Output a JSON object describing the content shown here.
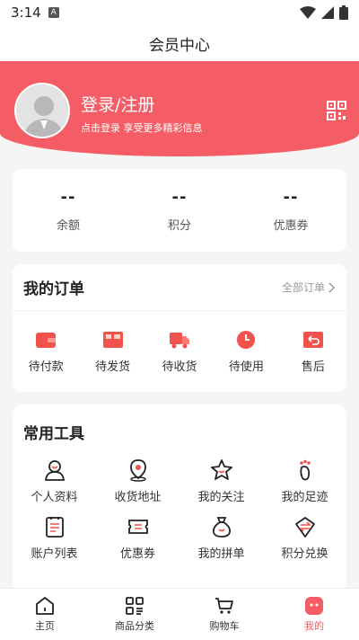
{
  "status_bar": {
    "time": "3:14"
  },
  "header": {
    "title": "会员中心"
  },
  "profile": {
    "login_label": "登录/注册",
    "login_hint": "点击登录 享受更多精彩信息"
  },
  "stats": [
    {
      "value": "--",
      "label": "余额"
    },
    {
      "value": "--",
      "label": "积分"
    },
    {
      "value": "--",
      "label": "优惠券"
    }
  ],
  "orders": {
    "title": "我的订单",
    "all_label": "全部订单",
    "items": [
      {
        "label": "待付款",
        "icon": "wallet-icon"
      },
      {
        "label": "待发货",
        "icon": "package-icon"
      },
      {
        "label": "待收货",
        "icon": "truck-icon"
      },
      {
        "label": "待使用",
        "icon": "clock-icon"
      },
      {
        "label": "售后",
        "icon": "return-icon"
      }
    ]
  },
  "tools": {
    "title": "常用工具",
    "items": [
      {
        "label": "个人资料",
        "icon": "user-icon"
      },
      {
        "label": "收货地址",
        "icon": "location-icon"
      },
      {
        "label": "我的关注",
        "icon": "star-icon"
      },
      {
        "label": "我的足迹",
        "icon": "footprint-icon"
      },
      {
        "label": "账户列表",
        "icon": "list-icon"
      },
      {
        "label": "优惠券",
        "icon": "coupon-icon"
      },
      {
        "label": "我的拼单",
        "icon": "moneybag-icon"
      },
      {
        "label": "积分兑换",
        "icon": "exchange-icon"
      }
    ]
  },
  "tabbar": [
    {
      "label": "主页",
      "icon": "home-icon"
    },
    {
      "label": "商品分类",
      "icon": "category-icon"
    },
    {
      "label": "购物车",
      "icon": "cart-icon"
    },
    {
      "label": "我的",
      "icon": "profile-icon",
      "active": true
    }
  ],
  "colors": {
    "accent": "#f45d65",
    "background": "#f5f5f5"
  }
}
